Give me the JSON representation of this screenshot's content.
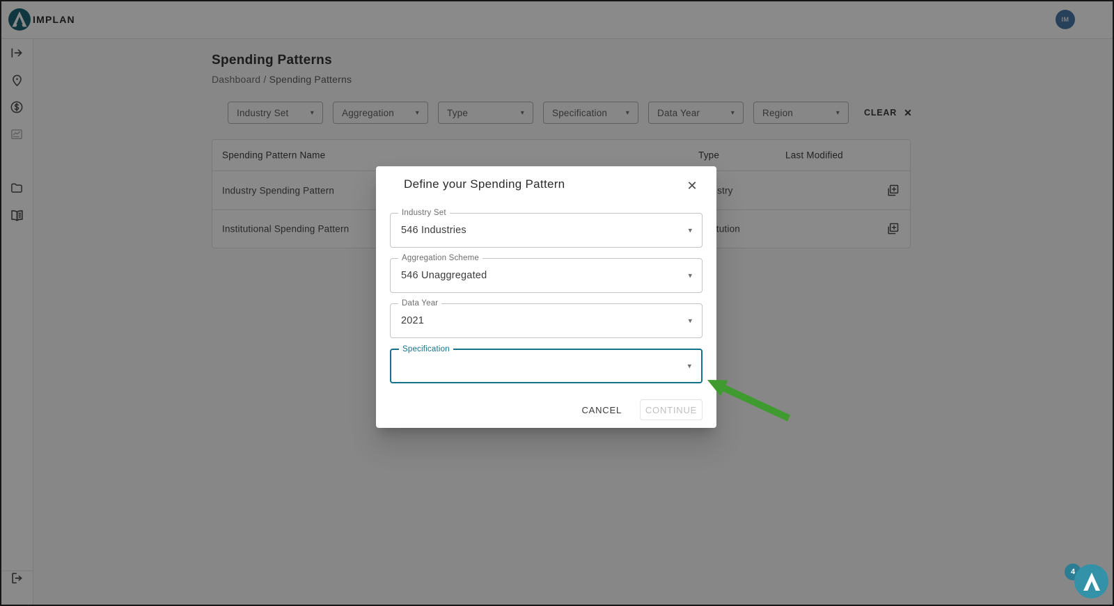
{
  "topbar": {
    "brand": "IMPLAN",
    "avatar_initials": "IM"
  },
  "sidebar": {
    "icons": [
      "drawer-expand",
      "map-pin",
      "dollar-circle",
      "chart-image",
      "folder",
      "open-book",
      "logout"
    ]
  },
  "page": {
    "title": "Spending Patterns",
    "breadcrumb": {
      "parent": "Dashboard",
      "separator": "/",
      "current": "Spending Patterns"
    }
  },
  "filters": {
    "items": [
      "Industry Set",
      "Aggregation",
      "Type",
      "Specification",
      "Data Year",
      "Region"
    ],
    "clear_label": "CLEAR",
    "clear_icon": "✕",
    "caret": "▾"
  },
  "table": {
    "columns": [
      "Spending Pattern Name",
      "Type",
      "Last Modified"
    ],
    "rows": [
      {
        "name": "Industry Spending Pattern",
        "type": "Industry",
        "last_modified": ""
      },
      {
        "name": "Institutional Spending Pattern",
        "type": "Institution",
        "last_modified": ""
      }
    ]
  },
  "modal": {
    "title": "Define your Spending Pattern",
    "close_icon": "✕",
    "caret": "▾",
    "fields": [
      {
        "label": "Industry Set",
        "value": "546 Industries"
      },
      {
        "label": "Aggregation Scheme",
        "value": "546 Unaggregated"
      },
      {
        "label": "Data Year",
        "value": "2021"
      },
      {
        "label": "Specification",
        "value": ""
      }
    ],
    "cancel_label": "CANCEL",
    "continue_label": "CONTINUE"
  },
  "chat_widget": {
    "badge_count": "4"
  },
  "colors": {
    "accent_teal": "#16718a",
    "annotation_green": "#3f9b2f",
    "widget_teal": "#3391a8",
    "badge_teal": "#2a7d92",
    "avatar_blue": "#4878a8"
  }
}
